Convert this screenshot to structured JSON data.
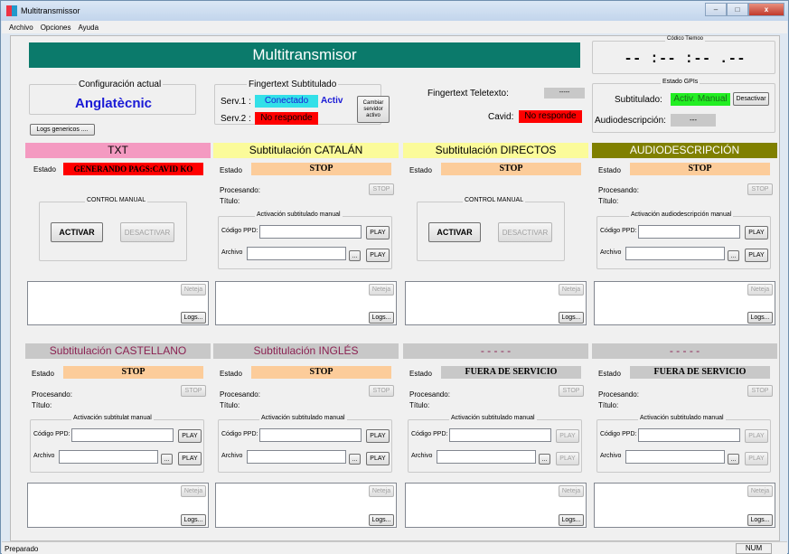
{
  "window": {
    "title": "Multitransmissor",
    "min": "–",
    "max": "□",
    "close": "x"
  },
  "menu": [
    "Archivo",
    "Opciones",
    "Ayuda"
  ],
  "banner": "Multitransmisor",
  "clock": {
    "label": "Códico Tiemoo",
    "value": "-- :-- :-- .--"
  },
  "config": {
    "label": "Configuración actual",
    "name": "Anglatècnic",
    "logs_button": "Logs genericos ...."
  },
  "fingertext_sub": {
    "label": "Fingertext Subtitulado",
    "serv1_label": "Serv.1 :",
    "serv1_status": "Conectado",
    "serv1_active": "Activ",
    "serv2_label": "Serv.2 :",
    "serv2_status": "No responde",
    "change_button": "Cambiar servidor activo"
  },
  "teletext": {
    "label": "Fingertext Teletexto:",
    "value": "-----",
    "cavid_label": "Cavid:",
    "cavid_status": "No responde"
  },
  "gpis": {
    "label": "Estado GPIs",
    "sub_label": "Subtitulado:",
    "sub_status": "Activ. Manual",
    "deactivate": "Desactivar",
    "ad_label": "Audiodescripción:",
    "ad_status": "---"
  },
  "colors": {
    "banner": "#0b7a6b",
    "green": "#22ee22",
    "red": "#ff0000",
    "cyan": "#33e0e8",
    "orange": "#fccc9a"
  },
  "common": {
    "estado": "Estado",
    "procesando": "Procesando:",
    "titulo": "Título:",
    "codigo": "Código PPD:",
    "archivo": "Archivo",
    "play": "PLAY",
    "stop": "STOP",
    "browse": "...",
    "neteja": "Neteja",
    "logs": "Logs..."
  },
  "panels": [
    {
      "title": "TXT",
      "state": "GENERANDO PAGS:CAVID KO",
      "control_label": "CONTROL MANUAL",
      "activate": "ACTIVAR",
      "deactivate": "DESACTIVAR"
    },
    {
      "title": "Subtitulación CATALÁN",
      "state": "STOP",
      "manual_label": "Activación subtitulado manual"
    },
    {
      "title": "Subtitulación DIRECTOS",
      "state": "STOP",
      "control_label": "CONTROL MANUAL",
      "activate": "ACTIVAR",
      "deactivate": "DESACTIVAR"
    },
    {
      "title": "AUDIODESCRIPCIÓN",
      "state": "STOP",
      "manual_label": "Activación audiodescripción manual"
    },
    {
      "title": "Subtitulación CASTELLANO",
      "state": "STOP",
      "manual_label": "Activación subtitulat manual"
    },
    {
      "title": "Subtitulación INGLÉS",
      "state": "STOP",
      "manual_label": "Activación subtitulado manual"
    },
    {
      "title": "- - - - -",
      "state": "FUERA DE SERVICIO",
      "manual_label": "Activación subtitulado manual"
    },
    {
      "title": "- - - - -",
      "state": "FUERA DE SERVICIO",
      "manual_label": "Activación subtitulado manual"
    }
  ],
  "status": {
    "text": "Preparado",
    "num": "NUM"
  }
}
